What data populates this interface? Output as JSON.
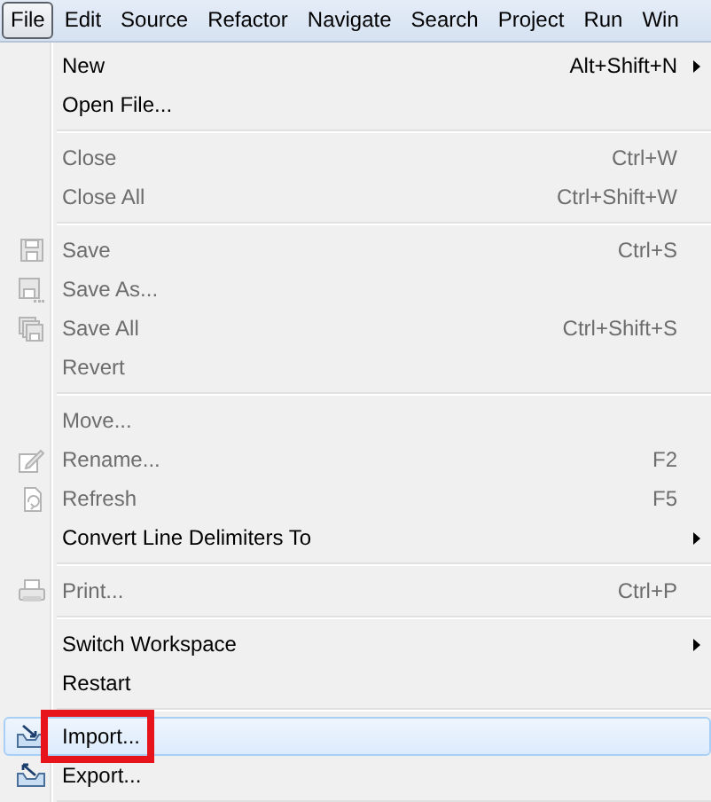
{
  "menubar": [
    {
      "label": "File",
      "selected": true
    },
    {
      "label": "Edit",
      "selected": false
    },
    {
      "label": "Source",
      "selected": false
    },
    {
      "label": "Refactor",
      "selected": false
    },
    {
      "label": "Navigate",
      "selected": false
    },
    {
      "label": "Search",
      "selected": false
    },
    {
      "label": "Project",
      "selected": false
    },
    {
      "label": "Run",
      "selected": false
    },
    {
      "label": "Win",
      "selected": false
    }
  ],
  "menu": {
    "groups": [
      [
        {
          "label": "New",
          "shortcut": "Alt+Shift+N",
          "submenu": true,
          "disabled": false,
          "highlighted": false
        },
        {
          "label": "Open File...",
          "disabled": false,
          "highlighted": false
        }
      ],
      [
        {
          "label": "Close",
          "shortcut": "Ctrl+W",
          "disabled": true,
          "highlighted": false
        },
        {
          "label": "Close All",
          "shortcut": "Ctrl+Shift+W",
          "disabled": true,
          "highlighted": false
        }
      ],
      [
        {
          "label": "Save",
          "shortcut": "Ctrl+S",
          "kind": "save",
          "disabled": true,
          "highlighted": false
        },
        {
          "label": "Save As...",
          "kind": "save-as",
          "disabled": true,
          "highlighted": false
        },
        {
          "label": "Save All",
          "shortcut": "Ctrl+Shift+S",
          "kind": "save-all",
          "disabled": true,
          "highlighted": false
        },
        {
          "label": "Revert",
          "disabled": true,
          "highlighted": false
        }
      ],
      [
        {
          "label": "Move...",
          "disabled": true,
          "highlighted": false
        },
        {
          "label": "Rename...",
          "shortcut": "F2",
          "kind": "rename",
          "disabled": true,
          "highlighted": false
        },
        {
          "label": "Refresh",
          "shortcut": "F5",
          "kind": "refresh",
          "disabled": true,
          "highlighted": false
        },
        {
          "label": "Convert Line Delimiters To",
          "submenu": true,
          "disabled": false,
          "highlighted": false
        }
      ],
      [
        {
          "label": "Print...",
          "shortcut": "Ctrl+P",
          "kind": "print",
          "disabled": true,
          "highlighted": false
        }
      ],
      [
        {
          "label": "Switch Workspace",
          "submenu": true,
          "disabled": false,
          "highlighted": false
        },
        {
          "label": "Restart",
          "disabled": false,
          "highlighted": false
        }
      ],
      [
        {
          "label": "Import...",
          "kind": "import",
          "disabled": false,
          "highlighted": true,
          "annotated": true
        },
        {
          "label": "Export...",
          "kind": "export",
          "disabled": false,
          "highlighted": false
        }
      ]
    ]
  }
}
